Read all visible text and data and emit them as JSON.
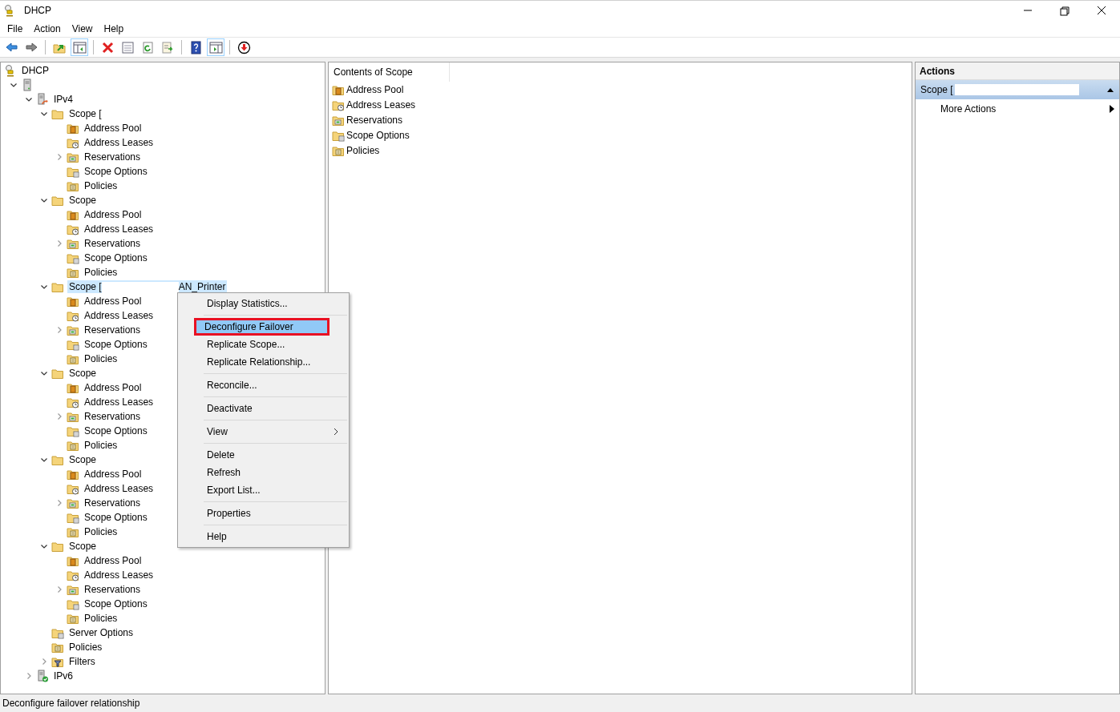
{
  "window": {
    "title": "DHCP"
  },
  "menu_bar": [
    {
      "label": "File"
    },
    {
      "label": "Action"
    },
    {
      "label": "View"
    },
    {
      "label": "Help"
    }
  ],
  "toolbar": [
    {
      "kind": "back",
      "pressed": false
    },
    {
      "kind": "forward",
      "pressed": false
    },
    {
      "kind": "separator"
    },
    {
      "kind": "up",
      "pressed": false
    },
    {
      "kind": "tree",
      "pressed": true
    },
    {
      "kind": "separator"
    },
    {
      "kind": "delete",
      "pressed": false
    },
    {
      "kind": "properties",
      "pressed": false
    },
    {
      "kind": "refresh",
      "pressed": false
    },
    {
      "kind": "export",
      "pressed": false
    },
    {
      "kind": "separator"
    },
    {
      "kind": "help",
      "pressed": false
    },
    {
      "kind": "actionpane",
      "pressed": true
    },
    {
      "kind": "separator"
    },
    {
      "kind": "download",
      "pressed": false
    }
  ],
  "tree": [
    {
      "label": "DHCP",
      "kind": "root",
      "selected": false,
      "children": [
        {
          "kind": "server",
          "expanded": true,
          "children": [
            {
              "label": "IPv4",
              "kind": "ipv4",
              "selected": false,
              "expanded": true,
              "children": [
                {
                  "label": "Scope [",
                  "kind": "folder",
                  "selected": false,
                  "expanded": true,
                  "children": [
                    {
                      "label": "Address Pool",
                      "kind": "pool",
                      "selected": false
                    },
                    {
                      "label": "Address Leases",
                      "kind": "leases",
                      "selected": false
                    },
                    {
                      "label": "Reservations",
                      "kind": "reservations",
                      "selected": false,
                      "expanded": false
                    },
                    {
                      "label": "Scope Options",
                      "kind": "options",
                      "selected": false
                    },
                    {
                      "label": "Policies",
                      "kind": "policies",
                      "selected": false
                    }
                  ]
                },
                {
                  "label": "Scope",
                  "kind": "folder",
                  "selected": false,
                  "expanded": true,
                  "children": [
                    {
                      "label": "Address Pool",
                      "kind": "pool",
                      "selected": false
                    },
                    {
                      "label": "Address Leases",
                      "kind": "leases",
                      "selected": false
                    },
                    {
                      "label": "Reservations",
                      "kind": "reservations",
                      "selected": false,
                      "expanded": false
                    },
                    {
                      "label": "Scope Options",
                      "kind": "options",
                      "selected": false
                    },
                    {
                      "label": "Policies",
                      "kind": "policies",
                      "selected": false
                    }
                  ]
                },
                {
                  "label": "Scope [",
                  "suffix": "AN_Printer",
                  "kind": "folder",
                  "selected": true,
                  "expanded": true,
                  "children": [
                    {
                      "label": "Address Pool",
                      "kind": "pool",
                      "selected": false
                    },
                    {
                      "label": "Address Leases",
                      "kind": "leases",
                      "selected": false
                    },
                    {
                      "label": "Reservations",
                      "kind": "reservations",
                      "selected": false,
                      "expanded": false
                    },
                    {
                      "label": "Scope Options",
                      "kind": "options",
                      "selected": false
                    },
                    {
                      "label": "Policies",
                      "kind": "policies",
                      "selected": false
                    }
                  ]
                },
                {
                  "label": "Scope",
                  "kind": "folder",
                  "selected": false,
                  "expanded": true,
                  "children": [
                    {
                      "label": "Address Pool",
                      "kind": "pool",
                      "selected": false
                    },
                    {
                      "label": "Address Leases",
                      "kind": "leases",
                      "selected": false
                    },
                    {
                      "label": "Reservations",
                      "kind": "reservations",
                      "selected": false,
                      "expanded": false
                    },
                    {
                      "label": "Scope Options",
                      "kind": "options",
                      "selected": false
                    },
                    {
                      "label": "Policies",
                      "kind": "policies",
                      "selected": false
                    }
                  ]
                },
                {
                  "label": "Scope",
                  "kind": "folder",
                  "selected": false,
                  "expanded": true,
                  "children": [
                    {
                      "label": "Address Pool",
                      "kind": "pool",
                      "selected": false
                    },
                    {
                      "label": "Address Leases",
                      "kind": "leases",
                      "selected": false
                    },
                    {
                      "label": "Reservations",
                      "kind": "reservations",
                      "selected": false,
                      "expanded": false
                    },
                    {
                      "label": "Scope Options",
                      "kind": "options",
                      "selected": false
                    },
                    {
                      "label": "Policies",
                      "kind": "policies",
                      "selected": false
                    }
                  ]
                },
                {
                  "label": "Scope",
                  "kind": "folder",
                  "selected": false,
                  "expanded": true,
                  "children": [
                    {
                      "label": "Address Pool",
                      "kind": "pool",
                      "selected": false
                    },
                    {
                      "label": "Address Leases",
                      "kind": "leases",
                      "selected": false
                    },
                    {
                      "label": "Reservations",
                      "kind": "reservations",
                      "selected": false,
                      "expanded": false
                    },
                    {
                      "label": "Scope Options",
                      "kind": "options",
                      "selected": false
                    },
                    {
                      "label": "Policies",
                      "kind": "policies",
                      "selected": false
                    }
                  ]
                },
                {
                  "label": "Server Options",
                  "kind": "options",
                  "selected": false
                },
                {
                  "label": "Policies",
                  "kind": "policies",
                  "selected": false
                },
                {
                  "label": "Filters",
                  "kind": "filter",
                  "selected": false,
                  "expanded": false
                }
              ]
            },
            {
              "label": "IPv6",
              "kind": "ipv6",
              "selected": false,
              "expanded": false
            }
          ]
        }
      ]
    }
  ],
  "contents": {
    "column": "Contents of Scope",
    "items": [
      {
        "label": "Address Pool",
        "kind": "pool"
      },
      {
        "label": "Address Leases",
        "kind": "leases"
      },
      {
        "label": "Reservations",
        "kind": "reservations"
      },
      {
        "label": "Scope Options",
        "kind": "options"
      },
      {
        "label": "Policies",
        "kind": "policies"
      }
    ]
  },
  "actions": {
    "title": "Actions",
    "section": "Scope [",
    "expanded": true,
    "items": [
      {
        "label": "More Actions",
        "kind": "submenu"
      }
    ]
  },
  "context_menu": {
    "items": [
      {
        "kind": "item",
        "label": "Display Statistics...",
        "selected": false,
        "outlined": false
      },
      {
        "kind": "separator"
      },
      {
        "kind": "item",
        "label": "Deconfigure Failover",
        "selected": true,
        "outlined": true
      },
      {
        "kind": "item",
        "label": "Replicate Scope...",
        "selected": false,
        "outlined": false
      },
      {
        "kind": "item",
        "label": "Replicate Relationship...",
        "selected": false,
        "outlined": false
      },
      {
        "kind": "separator"
      },
      {
        "kind": "item",
        "label": "Reconcile...",
        "selected": false,
        "outlined": false
      },
      {
        "kind": "separator"
      },
      {
        "kind": "item",
        "label": "Deactivate",
        "selected": false,
        "outlined": false
      },
      {
        "kind": "separator"
      },
      {
        "kind": "submenu",
        "label": "View",
        "selected": false,
        "outlined": false
      },
      {
        "kind": "separator"
      },
      {
        "kind": "item",
        "label": "Delete",
        "selected": false,
        "outlined": false
      },
      {
        "kind": "item",
        "label": "Refresh",
        "selected": false,
        "outlined": false
      },
      {
        "kind": "item",
        "label": "Export List...",
        "selected": false,
        "outlined": false
      },
      {
        "kind": "separator"
      },
      {
        "kind": "item",
        "label": "Properties",
        "selected": false,
        "outlined": false
      },
      {
        "kind": "separator"
      },
      {
        "kind": "item",
        "label": "Help",
        "selected": false,
        "outlined": false
      }
    ]
  },
  "status_bar": "Deconfigure failover relationship"
}
